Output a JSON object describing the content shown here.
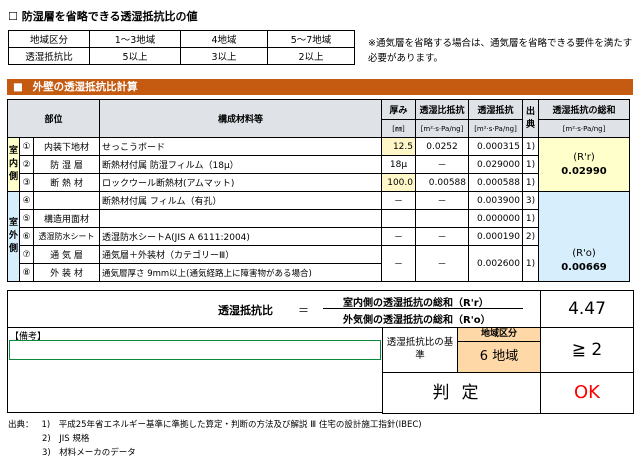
{
  "top": {
    "checkbox": "☐",
    "title": "防湿層を省略できる透湿抵抗比の値",
    "rows": [
      [
        "地域区分",
        "1～3地域",
        "4地域",
        "5～7地域"
      ],
      [
        "透湿抵抗比",
        "5以上",
        "3以上",
        "2以上"
      ]
    ],
    "note": "※通気層を省略する場合は、通気層を省略できる要件を満たす必要があります。"
  },
  "section": {
    "bullet": "■",
    "title": "外壁の透湿抵抗比計算"
  },
  "header": {
    "part": "部位",
    "materials": "構成材料等",
    "thickness": "厚み",
    "thickness_unit": "[㎜]",
    "ratio": "透湿比抵抗",
    "ratio_unit": "[m²·s·Pa/ng]",
    "resist": "透湿抵抗",
    "resist_unit": "[m²·s·Pa/ng]",
    "source": "出典",
    "sum": "透湿抵抗の総和",
    "sum_unit": "[m²·s·Pa/ng]"
  },
  "indoor_side": "室内側",
  "outdoor_side": "室外側",
  "rows": [
    {
      "no": "①",
      "part": "内装下地材",
      "material": "せっこうボード",
      "thickness": "12.5",
      "ratio": "0.0252",
      "resist": "0.000315",
      "source": "1)"
    },
    {
      "no": "②",
      "part": "防 湿 層",
      "material": "断熱材付属 防湿フィルム（18μ）",
      "thickness": "18μ",
      "ratio": "－",
      "resist": "0.029000",
      "source": "1)"
    },
    {
      "no": "③",
      "part": "断 熱 材",
      "material": "ロックウール断熱材(アムマット)",
      "thickness": "100.0",
      "ratio": "0.00588",
      "resist": "0.000588",
      "source": "1)"
    },
    {
      "no": "④",
      "part": "",
      "material": "断熱材付属 フィルム（有孔）",
      "thickness": "－",
      "ratio": "－",
      "resist": "0.003900",
      "source": "3)"
    },
    {
      "no": "⑤",
      "part": "構造用面材",
      "material": "",
      "thickness": "",
      "ratio": "",
      "resist": "0.000000",
      "source": "1)"
    },
    {
      "no": "⑥",
      "part": "透湿防水シート",
      "material": "透湿防水シートA(JIS A 6111:2004)",
      "thickness": "－",
      "ratio": "－",
      "resist": "0.000190",
      "source": "2)"
    },
    {
      "no": "⑦",
      "part": "通 気 層",
      "material": "通気層＋外装材（カテゴリーⅢ）",
      "thickness": "",
      "ratio": "",
      "resist": "",
      "source": ""
    },
    {
      "no": "⑧",
      "part": "外 装 材",
      "material": "通気層厚さ 9mm以上(通気経路上に障害物がある場合)",
      "thickness": "－",
      "ratio": "－",
      "resist": "0.002600",
      "source": "1)"
    }
  ],
  "sum_in": {
    "label": "(R'r)",
    "value": "0.02990"
  },
  "sum_out": {
    "label": "(R'o)",
    "value": "0.00669"
  },
  "ratio_calc": {
    "label": "透湿抵抗比",
    "eq": "＝",
    "numerator": "室内側の透湿抵抗の総和（R'r）",
    "denominator": "外気側の透湿抵抗の総和（R'o）",
    "result": "4.47"
  },
  "remarks": {
    "label": "【備考】"
  },
  "criterion": {
    "label": "透湿抵抗比の基準",
    "area_header": "地域区分",
    "area_value": "6 地域",
    "value": "≧ 2"
  },
  "judgement": {
    "label": "判定",
    "value": "OK"
  },
  "sources": {
    "label": "出典：",
    "items": [
      "1)　平成25年省エネルギー基準に準拠した算定・判断の方法及び解説 Ⅲ 住宅の設計施工指針(IBEC)",
      "2)　JIS 規格",
      "3)　材料メーカのデータ"
    ]
  },
  "colors": {
    "section": "#c55a11",
    "indoor": "#ffffcc",
    "outdoor": "#d7eefd",
    "area": "#ffd8a8",
    "ok": "#ff0000"
  }
}
